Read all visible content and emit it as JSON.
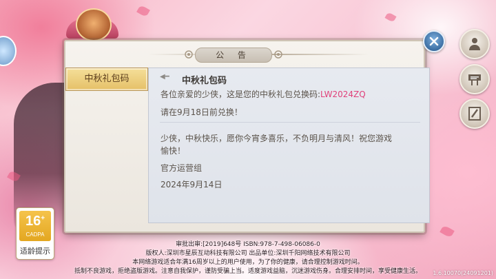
{
  "dialog": {
    "title": "公 告",
    "tabs": [
      {
        "label": "中秋礼包码"
      }
    ],
    "content": {
      "heading": "中秋礼包码",
      "line1_prefix": "各位亲爱的少侠，这是您的中秋礼包兑换码:",
      "line1_code": "LW2024ZQ",
      "line2": "请在9月18日前兑换！",
      "message_line1": "少侠，中秋快乐，愿你今宵多喜乐，不负明月与清风！祝您游戏",
      "message_line2": "愉快！",
      "signature": "官方运营组",
      "date": "2024年9月14日"
    }
  },
  "age_rating": {
    "number": "16",
    "sublabel": "CADPA",
    "label": "适龄提示"
  },
  "footer": {
    "line1": "审批出审:[2019]648号 ISBN:978-7-498-06086-0",
    "line2": "版权人:深圳市星辰互动科技有限公司 出品单位:深圳千阳网络技术有限公司",
    "line3": "本网络游戏适合年满16周岁以上的用户使用，为了你的健康，请合理控制游戏时间。",
    "line4": "抵制不良游戏，拒绝盗版游戏。注意自我保护，谨防受骗上当。适度游戏益脑，沉迷游戏伤身。合理安排时间，享受健康生活。"
  },
  "version": "1.6.10070(24091201)",
  "icons": {
    "side_buttons": [
      "profile-icon",
      "signboard-icon",
      "edit-icon"
    ],
    "close": "close-icon"
  },
  "colors": {
    "code_highlight": "#e0407a",
    "tab_active": "#e5c067"
  }
}
